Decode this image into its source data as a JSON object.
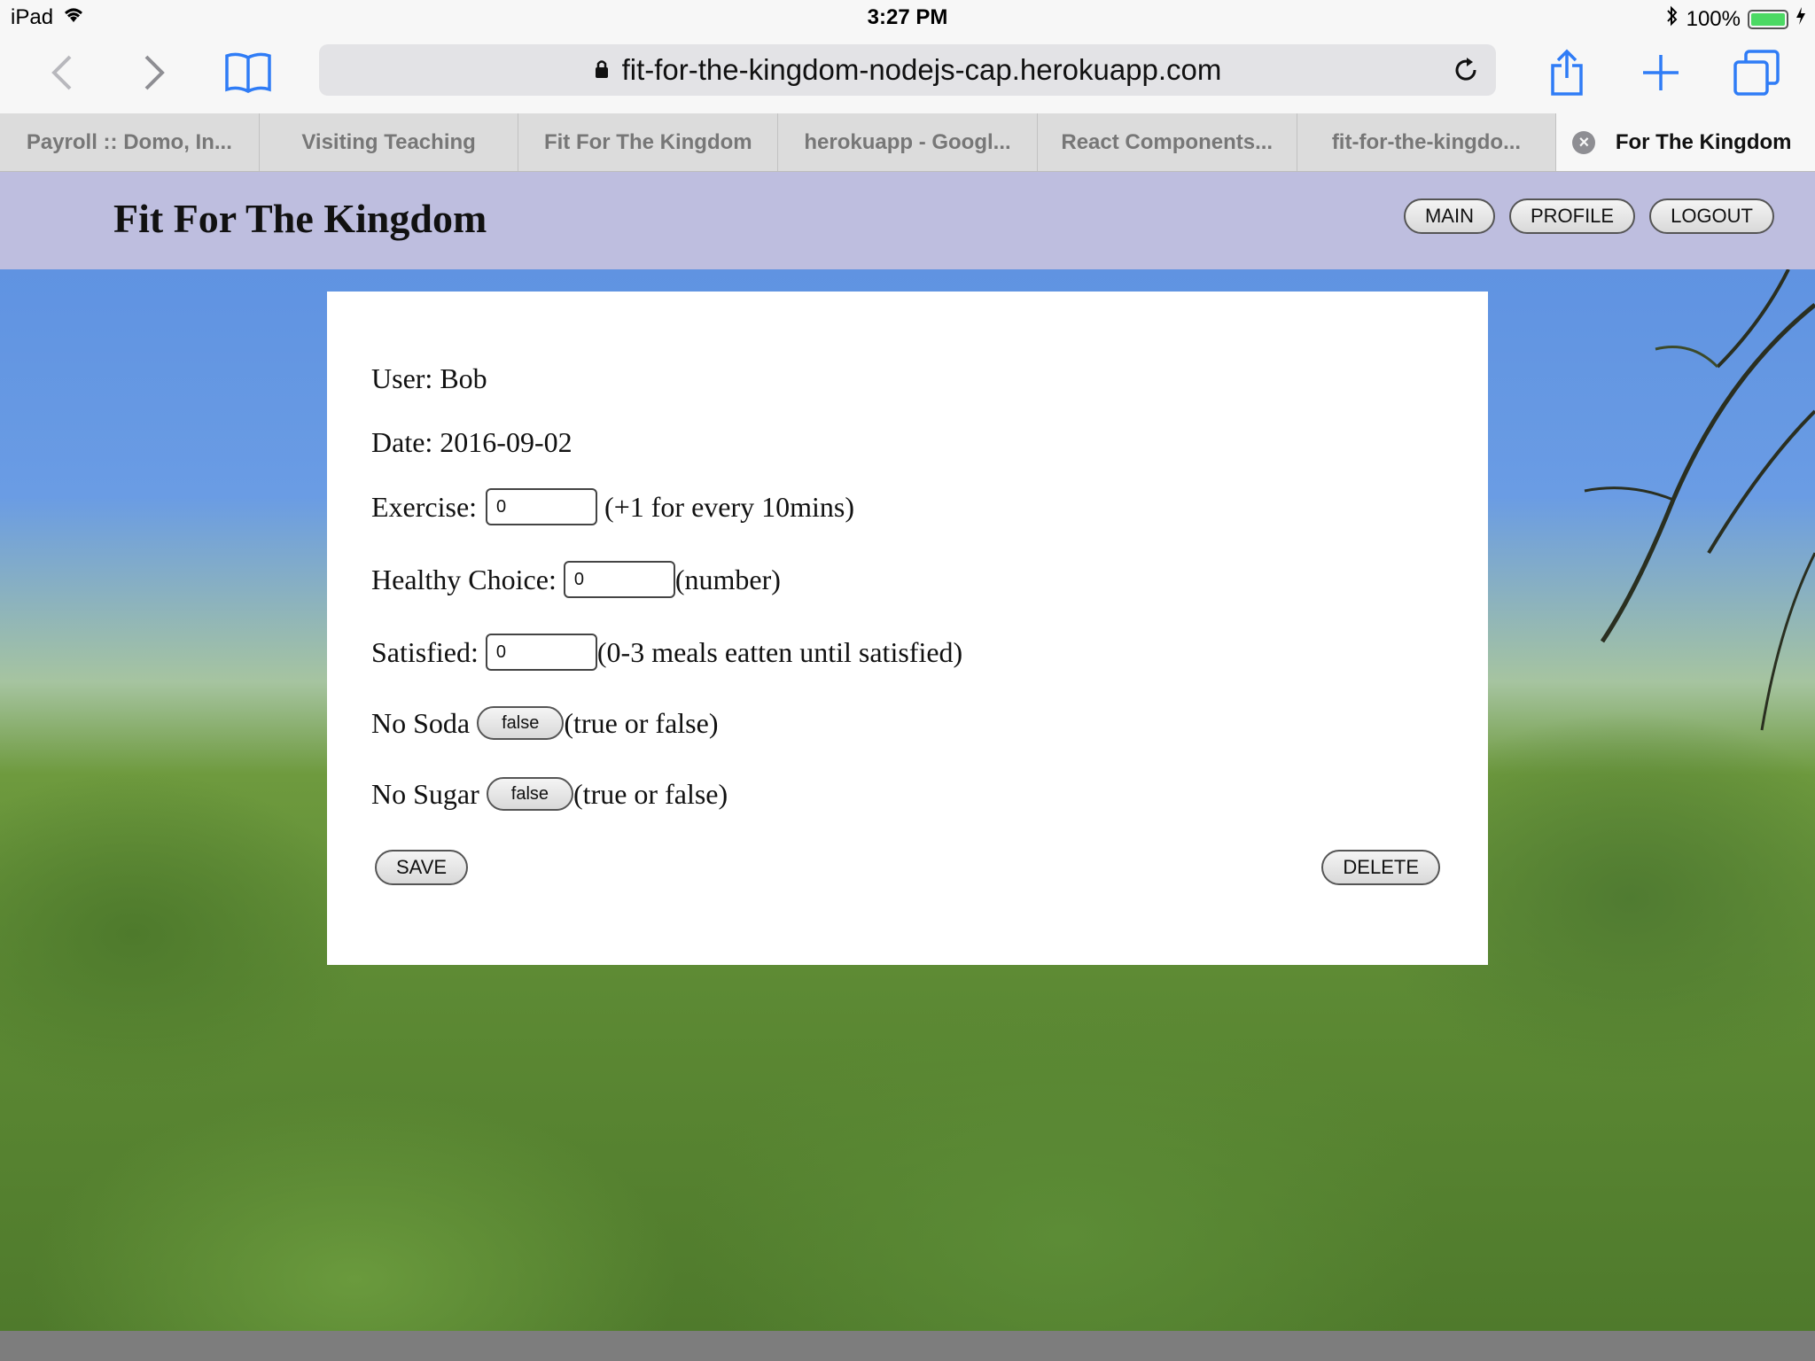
{
  "status_bar": {
    "device": "iPad",
    "time": "3:27 PM",
    "battery_text": "100%",
    "battery_level": 1.0
  },
  "browser": {
    "url": "fit-for-the-kingdom-nodejs-cap.herokuapp.com",
    "tabs": [
      {
        "label": "Payroll :: Domo, In..."
      },
      {
        "label": "Visiting Teaching"
      },
      {
        "label": "Fit For The Kingdom"
      },
      {
        "label": "herokuapp - Googl..."
      },
      {
        "label": "React Components..."
      },
      {
        "label": "fit-for-the-kingdo..."
      },
      {
        "label": "For The Kingdom"
      }
    ],
    "active_tab_index": 6
  },
  "site": {
    "title": "Fit For The Kingdom",
    "nav": {
      "main": "MAIN",
      "profile": "PROFILE",
      "logout": "LOGOUT"
    }
  },
  "form": {
    "user": "User: Bob",
    "date": "Date: 2016-09-02",
    "exercise": {
      "label": "Exercise:",
      "value": "0",
      "hint": "(+1 for every 10mins)"
    },
    "healthy_choice": {
      "label": "Healthy Choice:",
      "value": "0",
      "hint": "(number)"
    },
    "satisfied": {
      "label": "Satisfied:",
      "value": "0",
      "hint": "(0-3 meals eatten until satisfied)"
    },
    "no_soda": {
      "label": "No Soda",
      "value": "false",
      "hint": "(true or false)"
    },
    "no_sugar": {
      "label": "No Sugar",
      "value": "false",
      "hint": "(true or false)"
    },
    "save_label": "SAVE",
    "delete_label": "DELETE"
  },
  "colors": {
    "header_band": "#bebedf",
    "battery_fill": "#4cd964",
    "safari_blue": "#2f7cf6"
  }
}
